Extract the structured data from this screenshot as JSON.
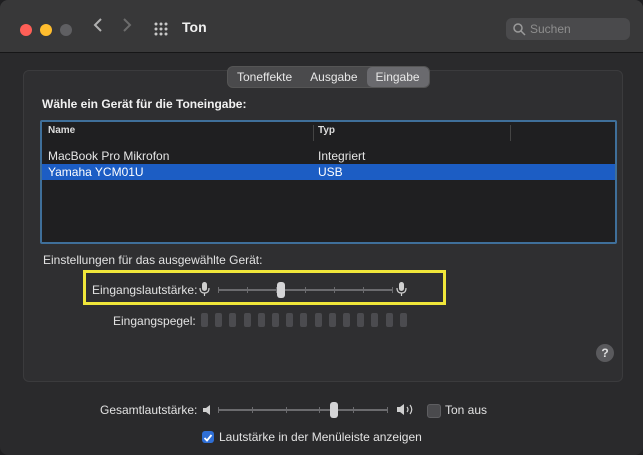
{
  "window": {
    "title": "Ton"
  },
  "search": {
    "placeholder": "Suchen"
  },
  "tabs": [
    {
      "label": "Toneffekte",
      "selected": false
    },
    {
      "label": "Ausgabe",
      "selected": false
    },
    {
      "label": "Eingabe",
      "selected": true
    }
  ],
  "device_section": {
    "heading": "Wähle ein Gerät für die Toneingabe:",
    "columns": [
      "Name",
      "Typ"
    ],
    "rows": [
      {
        "name": "MacBook Pro Mikrofon",
        "type": "Integriert",
        "selected": false
      },
      {
        "name": "Yamaha YCM01U",
        "type": "USB",
        "selected": true
      }
    ]
  },
  "settings": {
    "heading": "Einstellungen für das ausgewählte Gerät:",
    "input_volume_label": "Eingangslautstärke:",
    "input_volume_level": 0.36,
    "input_level_label": "Eingangspegel:",
    "input_level_segments": 15,
    "input_level_active": 0
  },
  "footer": {
    "output_volume_label": "Gesamtlautstärke:",
    "output_volume_level": 0.68,
    "mute_label": "Ton aus",
    "mute_checked": false,
    "menubar_label": "Lautstärke in der Menüleiste anzeigen",
    "menubar_checked": true
  },
  "colors": {
    "accent": "#1c5dc4",
    "highlight_box": "#f0e63a",
    "checkbox": "#2f6fd6"
  }
}
